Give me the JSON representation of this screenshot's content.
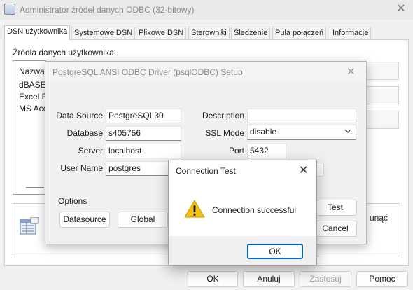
{
  "admin": {
    "title": "Administrator źródeł danych ODBC (32-bitowy)",
    "close_glyph": "✕",
    "tabs": [
      {
        "label": "DSN użytkownika",
        "active": true
      },
      {
        "label": "Systemowe DSN"
      },
      {
        "label": "Plikowe DSN"
      },
      {
        "label": "Sterowniki"
      },
      {
        "label": "Śledzenie"
      },
      {
        "label": "Pula połączeń"
      },
      {
        "label": "Informacje"
      }
    ],
    "sources_label": "Źródła danych użytkownika:",
    "list_header": "Nazwa",
    "list_rows": [
      "dBASE",
      "Excel Fi",
      "MS Acc"
    ],
    "info_text_partial": "unąć",
    "buttons": {
      "ok": "OK",
      "cancel": "Anuluj",
      "apply": "Zastosuj",
      "help": "Pomoc"
    }
  },
  "setup": {
    "title": "PostgreSQL ANSI ODBC Driver (psqlODBC) Setup",
    "close_glyph": "✕",
    "labels": {
      "data_source": "Data Source",
      "database": "Database",
      "server": "Server",
      "user_name": "User Name",
      "description": "Description",
      "ssl_mode": "SSL Mode",
      "port": "Port"
    },
    "values": {
      "data_source": "PostgreSQL30",
      "database": "s405756",
      "server": "localhost",
      "user_name": "postgres",
      "description": "",
      "ssl_mode": "disable",
      "port": "5432"
    },
    "options_label": "Options",
    "buttons": {
      "datasource": "Datasource",
      "global": "Global",
      "test": "Test",
      "cancel": "Cancel"
    }
  },
  "connection_test": {
    "title": "Connection Test",
    "close_glyph": "✕",
    "message": "Connection successful",
    "ok": "OK"
  },
  "colors": {
    "accent": "#0067c0",
    "warning_yellow": "#f5c211"
  }
}
